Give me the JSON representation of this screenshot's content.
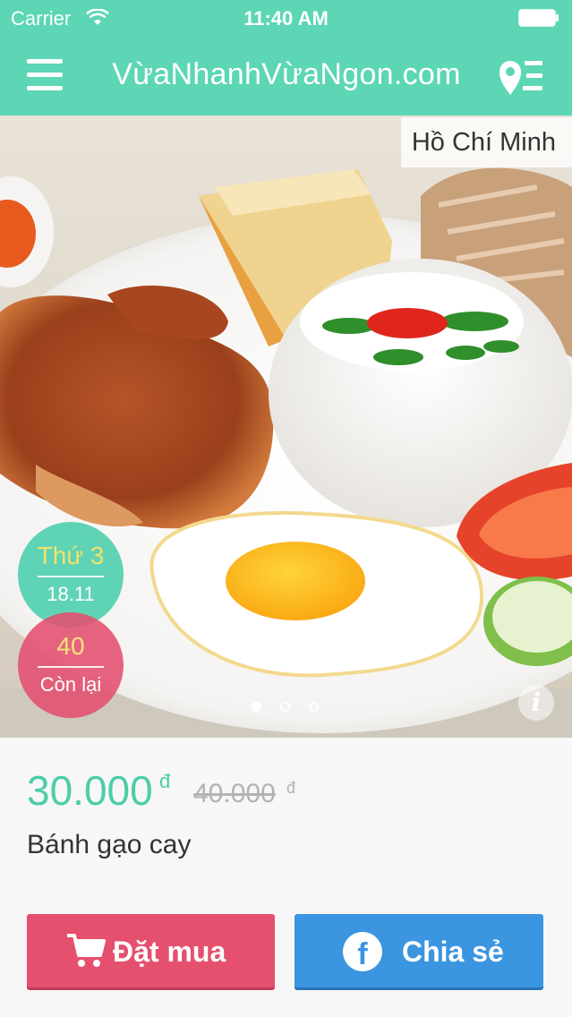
{
  "status_bar": {
    "carrier": "Carrier",
    "time": "11:40 AM"
  },
  "nav": {
    "title": "VừaNhanhVừaNgon.com",
    "menu_icon": "hamburger-icon",
    "location_icon": "map-pin-list-icon"
  },
  "hero": {
    "city": "Hồ Chí Minh",
    "day_label": "Thứ 3",
    "date": "18.11",
    "remaining_count": "40",
    "remaining_label": "Còn lại",
    "carousel": {
      "page_count": 3,
      "active_index": 0
    },
    "info_icon": "info-icon"
  },
  "deal": {
    "price": "30.000",
    "price_unit": "đ",
    "old_price": "40.000",
    "old_price_unit": "đ",
    "name": "Bánh gạo cay"
  },
  "actions": {
    "order_label": "Đặt mua",
    "order_icon": "shopping-cart-icon",
    "share_label": "Chia sẻ",
    "share_icon": "facebook-icon"
  },
  "colors": {
    "accent_green": "#5cd6b4",
    "price_green": "#4ccda9",
    "order_red": "#e5506f",
    "share_blue": "#3b95e0"
  }
}
